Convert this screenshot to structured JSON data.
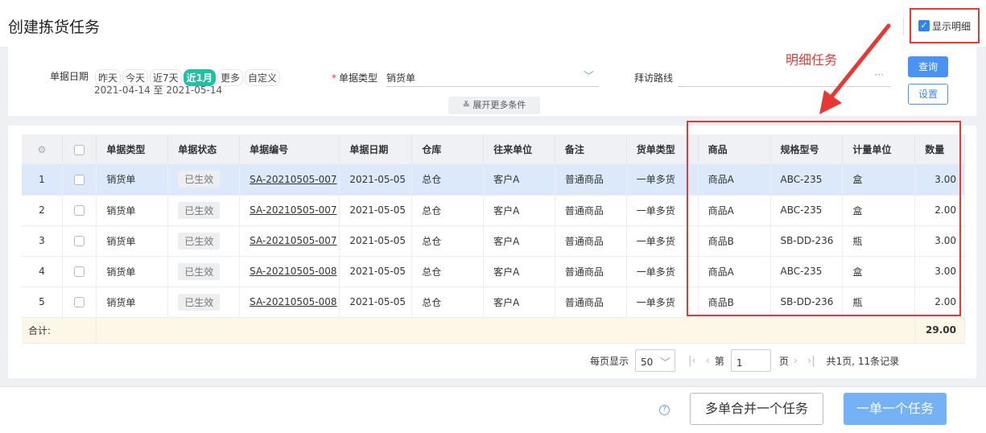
{
  "page": {
    "title": "创建拣货任务",
    "show_detail_label": "显示明细",
    "show_detail_checked": true
  },
  "filters": {
    "date_label": "单据日期",
    "date_options": [
      "昨天",
      "今天",
      "近7天",
      "近1月",
      "更多",
      "自定义"
    ],
    "date_active": "近1月",
    "date_range": "2021-04-14 至 2021-05-14",
    "doc_type_label": "单据类型",
    "doc_type_value": "销货单",
    "route_label": "拜访路线",
    "route_dots": "···",
    "expand_label": "展开更多条件",
    "query_label": "查询",
    "settings_label": "设置"
  },
  "annotation": {
    "text": "明细任务",
    "color": "#e53935"
  },
  "table": {
    "headers": [
      "单据类型",
      "单据状态",
      "单据编号",
      "单据日期",
      "仓库",
      "往来单位",
      "备注",
      "货单类型",
      "商品",
      "规格型号",
      "计量单位",
      "数量"
    ],
    "rows": [
      {
        "idx": "1",
        "type": "销货单",
        "status": "已生效",
        "no": "SA-20210505-007",
        "date": "2021-05-05",
        "wh": "总仓",
        "partner": "客户A",
        "note": "普通商品",
        "kind": "一单多货",
        "product": "商品A",
        "spec": "ABC-235",
        "unit": "盒",
        "qty": "3.00"
      },
      {
        "idx": "2",
        "type": "销货单",
        "status": "已生效",
        "no": "SA-20210505-007",
        "date": "2021-05-05",
        "wh": "总仓",
        "partner": "客户A",
        "note": "普通商品",
        "kind": "一单多货",
        "product": "商品A",
        "spec": "ABC-235",
        "unit": "盒",
        "qty": "2.00"
      },
      {
        "idx": "3",
        "type": "销货单",
        "status": "已生效",
        "no": "SA-20210505-007",
        "date": "2021-05-05",
        "wh": "总仓",
        "partner": "客户A",
        "note": "普通商品",
        "kind": "一单多货",
        "product": "商品B",
        "spec": "SB-DD-236",
        "unit": "瓶",
        "qty": "3.00"
      },
      {
        "idx": "4",
        "type": "销货单",
        "status": "已生效",
        "no": "SA-20210505-008",
        "date": "2021-05-05",
        "wh": "总仓",
        "partner": "客户A",
        "note": "普通商品",
        "kind": "一单多货",
        "product": "商品A",
        "spec": "ABC-235",
        "unit": "盒",
        "qty": "3.00"
      },
      {
        "idx": "5",
        "type": "销货单",
        "status": "已生效",
        "no": "SA-20210505-008",
        "date": "2021-05-05",
        "wh": "总仓",
        "partner": "客户A",
        "note": "普通商品",
        "kind": "一单多货",
        "product": "商品B",
        "spec": "SB-DD-236",
        "unit": "瓶",
        "qty": "2.00"
      }
    ],
    "total_label": "合计:",
    "total_qty": "29.00"
  },
  "pager": {
    "per_page_label": "每页显示",
    "per_page_value": "50",
    "page_prefix": "第",
    "page_value": "1",
    "page_suffix": "页",
    "summary": "共1页, 11条记录"
  },
  "footer": {
    "merge_label": "多单合并一个任务",
    "single_label": "一单一个任务"
  },
  "colors": {
    "accent": "#4a93f2",
    "active_chip": "#1fc0a5",
    "highlight_border": "#e53935"
  }
}
